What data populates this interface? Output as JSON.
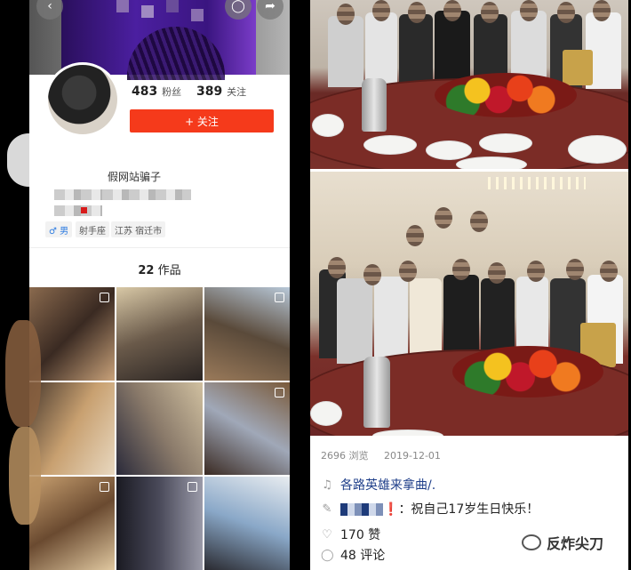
{
  "profile": {
    "followers_count": "483",
    "followers_label": "粉丝",
    "following_count": "389",
    "following_label": "关注",
    "follow_button": "+ 关注",
    "bio_text": "假网站骗子",
    "tags": [
      "♂ 男",
      "射手座",
      "江苏 宿迁市"
    ],
    "works_count": "22",
    "works_label": "作品"
  },
  "post": {
    "views": "2696 浏览",
    "date": "2019-12-01",
    "music": "各路英雄来拿曲/.",
    "caption_suffix": "：祝自己17岁生日快乐！",
    "caption_excl": "❗",
    "likes": "170 赞",
    "comments": "48 评论"
  },
  "icons": {
    "back": "chevron-left-icon",
    "chat": "chat-bubble-icon",
    "share": "share-arrow-icon",
    "music": "music-note-icon",
    "edit": "pencil-icon",
    "like": "heart-icon",
    "comment": "comment-icon",
    "wechat": "wechat-logo-icon"
  },
  "colors": {
    "follow_button": "#f53a1b",
    "music_link": "#1f3f8a",
    "male_symbol": "#2f7de1"
  },
  "watermark": "反炸尖刀"
}
